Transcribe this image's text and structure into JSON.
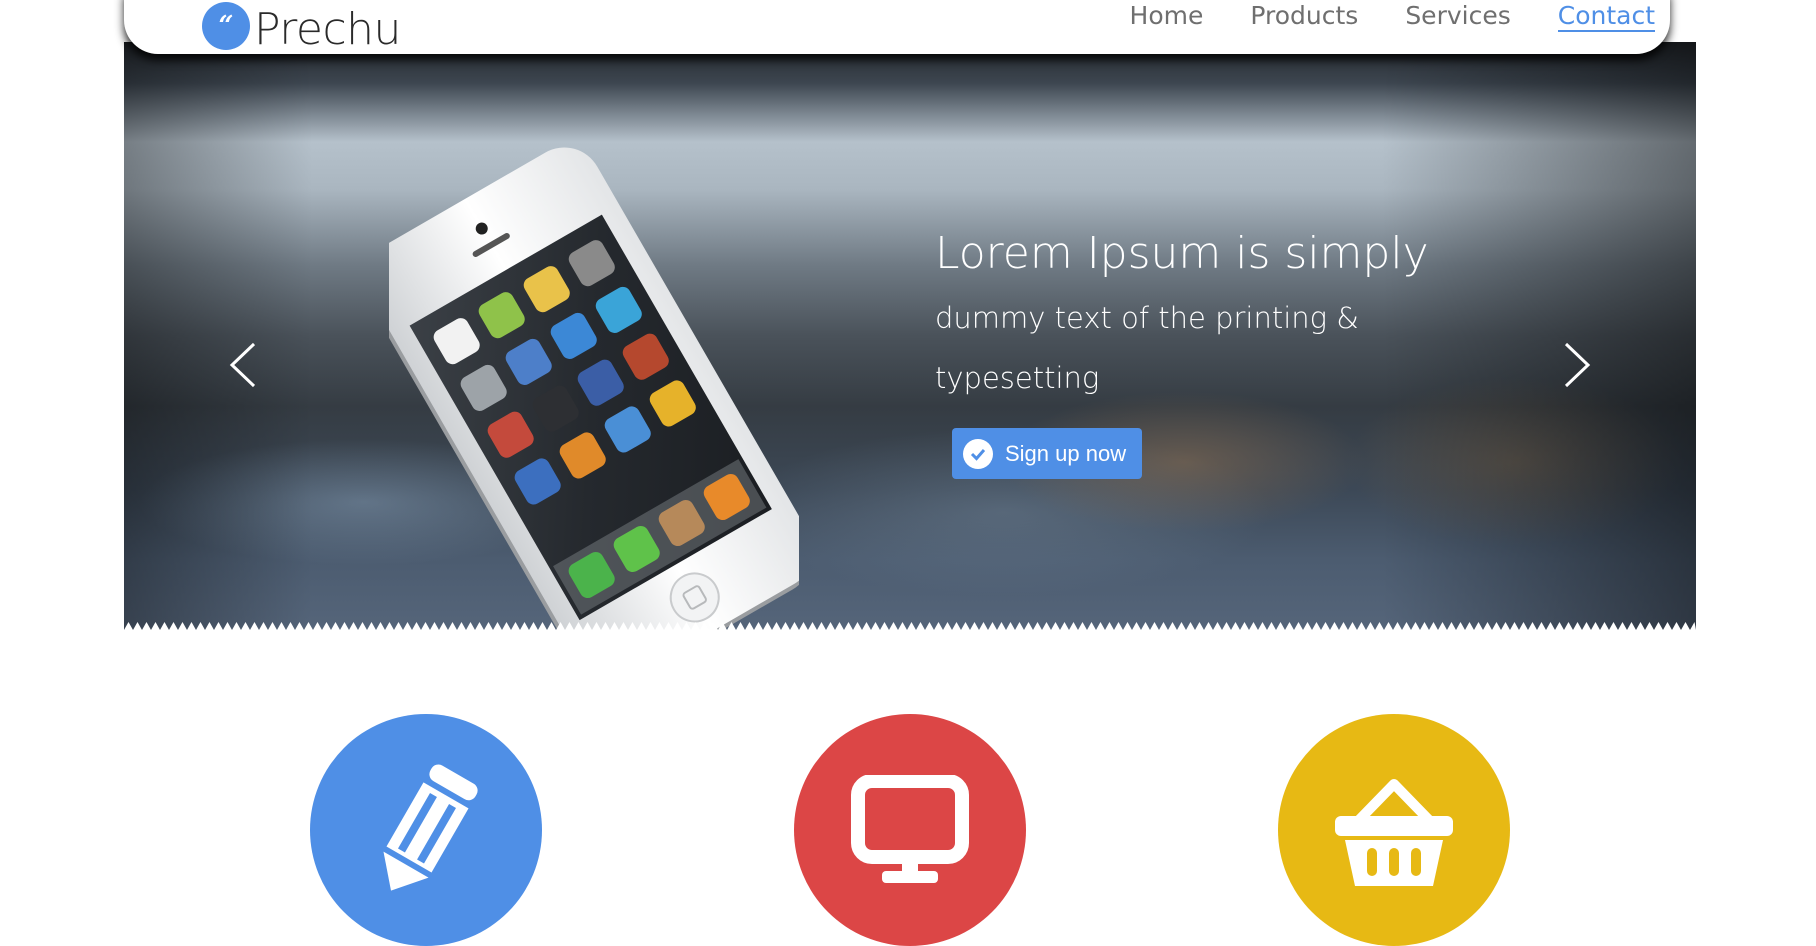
{
  "header": {
    "logo_mark": "“",
    "logo_text": "Prechu",
    "nav": [
      {
        "label": "Home",
        "active": false
      },
      {
        "label": "Products",
        "active": false
      },
      {
        "label": "Services",
        "active": false
      },
      {
        "label": "Contact",
        "active": true
      }
    ]
  },
  "hero": {
    "title": "Lorem Ipsum is simply",
    "subtitle": "dummy text of the printing & typesetting",
    "cta_label": "Sign up now",
    "prev_icon": "chevron-left-icon",
    "next_icon": "chevron-right-icon"
  },
  "features": [
    {
      "icon": "pencil-icon",
      "color": "#4f8fe6"
    },
    {
      "icon": "monitor-icon",
      "color": "#dc4646"
    },
    {
      "icon": "basket-icon",
      "color": "#e7b914"
    }
  ],
  "colors": {
    "accent": "#4f8fe6",
    "nav_text": "#6f6f6f"
  }
}
